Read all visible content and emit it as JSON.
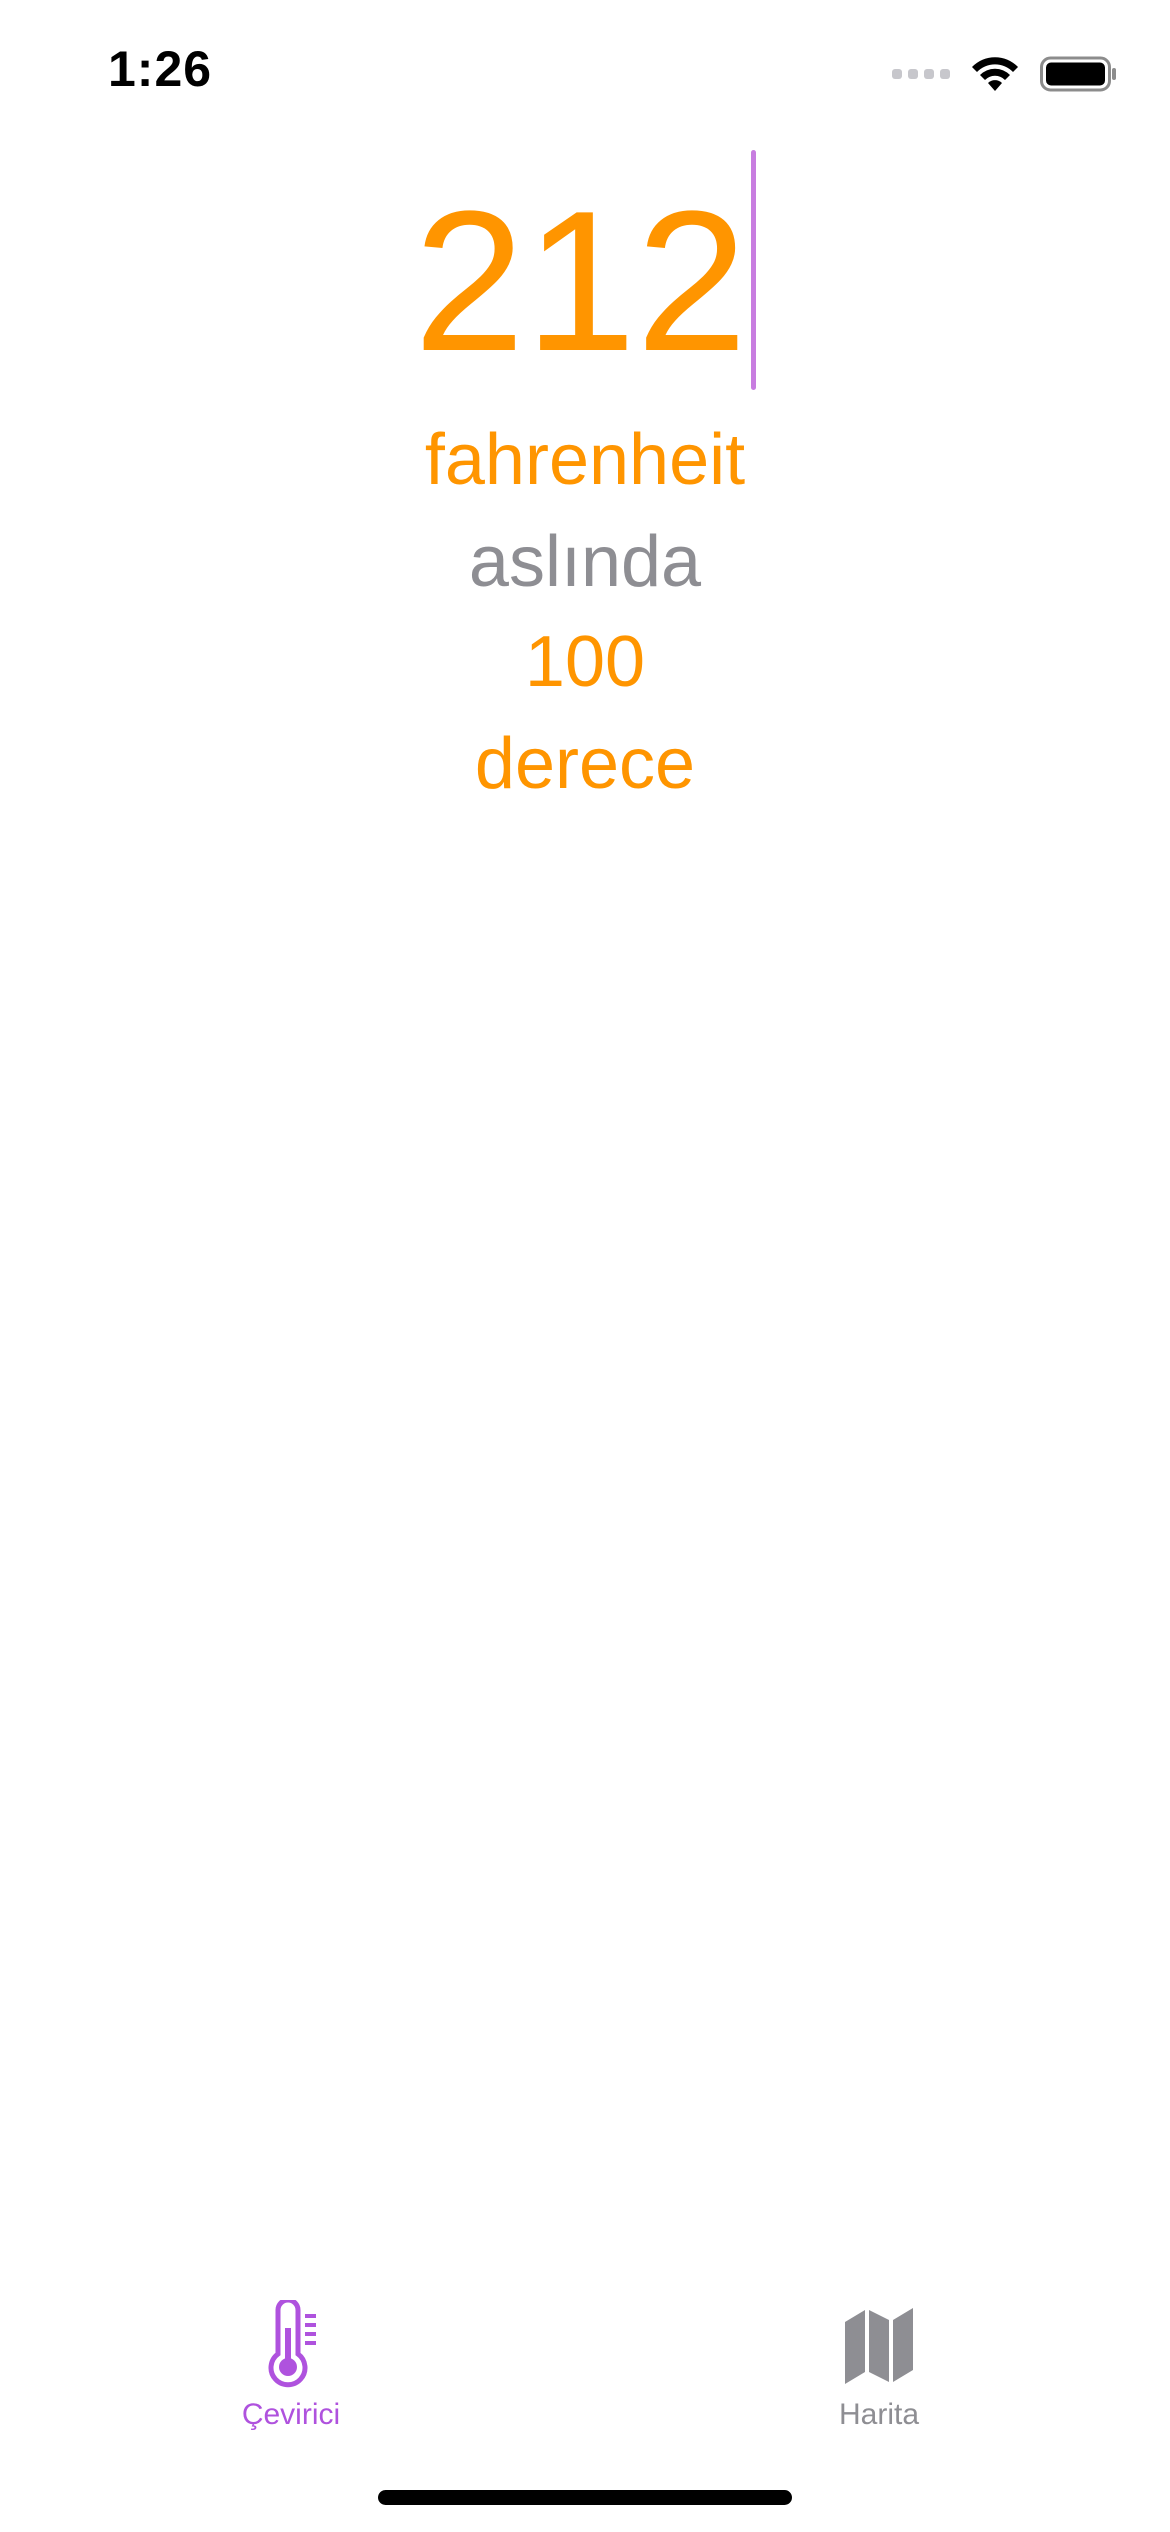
{
  "status_bar": {
    "time": "1:26"
  },
  "converter": {
    "input_value": "212",
    "input_unit": "fahrenheit",
    "connector": "aslında",
    "result_value": "100",
    "result_unit": "derece"
  },
  "tab_bar": {
    "tabs": [
      {
        "label": "Çevirici",
        "icon": "thermometer-icon",
        "selected": true
      },
      {
        "label": "Harita",
        "icon": "map-icon",
        "selected": false
      }
    ]
  },
  "colors": {
    "accent": "#FF9500",
    "tint": "#AF52DE",
    "secondary_text": "#8e8e93"
  }
}
